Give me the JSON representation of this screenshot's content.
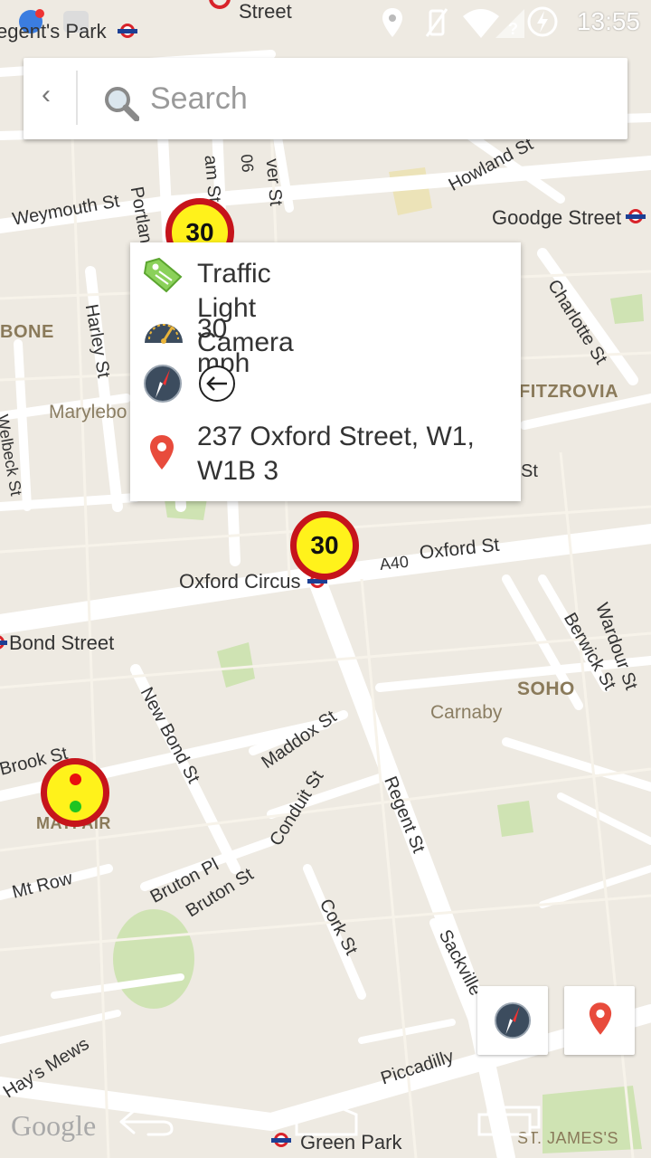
{
  "status_bar": {
    "time": "13:55"
  },
  "search": {
    "placeholder": "Search",
    "value": ""
  },
  "popup": {
    "type": "Traffic Light Camera",
    "speed": "30 mph",
    "address": "237 Oxford Street, W1, W1B 3"
  },
  "markers": {
    "speed_marker_1": "30",
    "speed_marker_2": "30"
  },
  "map_labels": {
    "regents_park": "egent's Park",
    "street_top": "Street",
    "weymouth": "Weymouth St",
    "portland": "Portland",
    "am_st": "am St",
    "n06": "06",
    "ver_st": "ver St",
    "howland": "Howland St",
    "goodge": "Goodge Street",
    "bone": "BONE",
    "harley": "Harley St",
    "marylebo": "Marylebo",
    "welbeck": "Welbeck St",
    "charlotte": "Charlotte St",
    "fitzrovia": "FITZROVIA",
    "st_right": "St",
    "oxford_circus": "Oxford Circus",
    "a40": "A40",
    "oxford_st": "Oxford St",
    "bond_street": "Bond Street",
    "berwick": "Berwick St",
    "wardour": "Wardour St",
    "new_bond": "New Bond St",
    "maddox": "Maddox St",
    "soho": "SOHO",
    "carnaby": "Carnaby",
    "brook": "Brook St",
    "mayfair": "MAYFAIR",
    "conduit": "Conduit St",
    "regent": "Regent St",
    "mt_row": "Mt Row",
    "bruton_pl": "Bruton Pl",
    "bruton_st": "Bruton St",
    "cork": "Cork St",
    "sackville": "Sackville",
    "hays_mews": "Hay's Mews",
    "piccadilly": "Piccadilly",
    "green_park": "Green Park",
    "st_james": "ST. JAMES'S",
    "google": "Google"
  },
  "colors": {
    "sign_border": "#c6141b",
    "sign_fill": "#fff21b",
    "map_bg": "#eeeae2",
    "road": "#ffffff",
    "park": "#cfe3b3"
  },
  "icons": [
    "search-icon",
    "tag-icon",
    "speedometer-icon",
    "compass-icon",
    "arrow-left-circle-icon",
    "location-pin-icon",
    "back-chevron-icon"
  ]
}
